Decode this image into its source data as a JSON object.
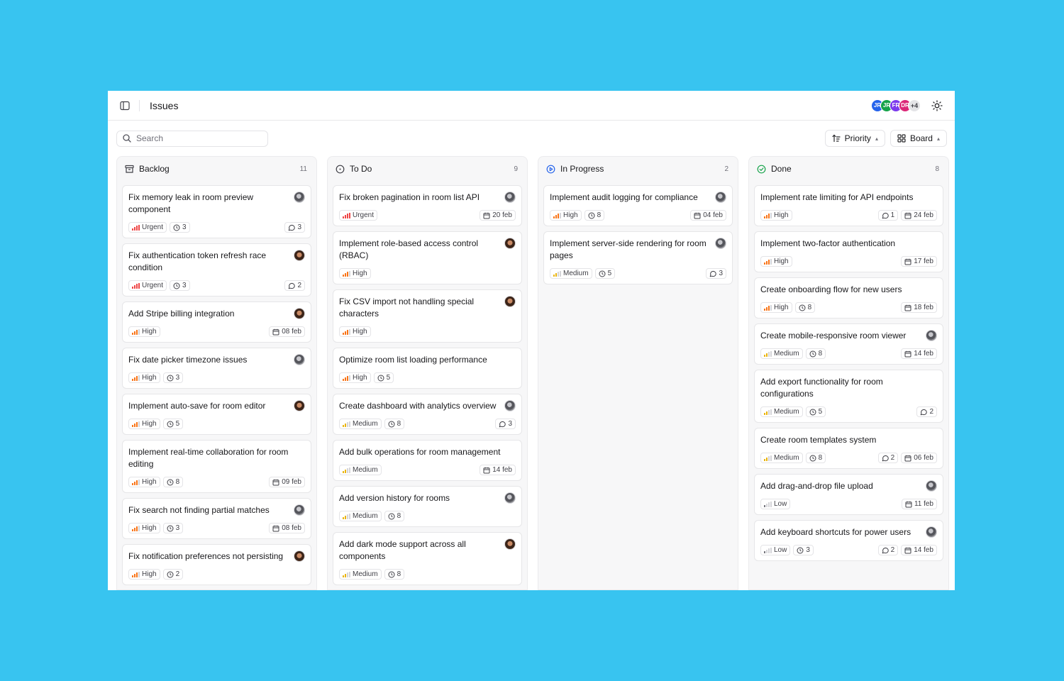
{
  "header": {
    "title": "Issues",
    "avatars": [
      {
        "initials": "JR",
        "color": "#2563eb"
      },
      {
        "initials": "JR",
        "color": "#16a34a"
      },
      {
        "initials": "FR",
        "color": "#7c3aed"
      },
      {
        "initials": "DR",
        "color": "#db2777"
      }
    ],
    "avatars_more": "+4"
  },
  "toolbar": {
    "search_placeholder": "Search",
    "priority_label": "Priority",
    "board_label": "Board"
  },
  "priority_colors": {
    "Urgent": "#ef4444",
    "High": "#f97316",
    "Medium": "#eab308",
    "Low": "#71717a"
  },
  "columns": [
    {
      "id": "backlog",
      "title": "Backlog",
      "count": "11",
      "icon": "archive-icon",
      "cards": [
        {
          "title": "Fix memory leak in room preview component",
          "avatar": "gray",
          "priority": "Urgent",
          "estimate": "3",
          "comments": "3",
          "date": ""
        },
        {
          "title": "Fix authentication token refresh race condition",
          "avatar": "brown",
          "priority": "Urgent",
          "estimate": "3",
          "comments": "2",
          "date": ""
        },
        {
          "title": "Add Stripe billing integration",
          "avatar": "brown",
          "priority": "High",
          "estimate": "",
          "comments": "",
          "date": "08 feb"
        },
        {
          "title": "Fix date picker timezone issues",
          "avatar": "gray",
          "priority": "High",
          "estimate": "3",
          "comments": "",
          "date": ""
        },
        {
          "title": "Implement auto-save for room editor",
          "avatar": "brown",
          "priority": "High",
          "estimate": "5",
          "comments": "",
          "date": ""
        },
        {
          "title": "Implement real-time collaboration for room editing",
          "avatar": "",
          "priority": "High",
          "estimate": "8",
          "comments": "",
          "date": "09 feb"
        },
        {
          "title": "Fix search not finding partial matches",
          "avatar": "gray",
          "priority": "High",
          "estimate": "3",
          "comments": "",
          "date": "08 feb"
        },
        {
          "title": "Fix notification preferences not persisting",
          "avatar": "brown",
          "priority": "High",
          "estimate": "2",
          "comments": "",
          "date": ""
        }
      ]
    },
    {
      "id": "todo",
      "title": "To Do",
      "count": "9",
      "icon": "circle-dashed-icon",
      "cards": [
        {
          "title": "Fix broken pagination in room list API",
          "avatar": "gray",
          "priority": "Urgent",
          "estimate": "",
          "comments": "",
          "date": "20 feb"
        },
        {
          "title": "Implement role-based access control (RBAC)",
          "avatar": "brown",
          "priority": "High",
          "estimate": "",
          "comments": "",
          "date": ""
        },
        {
          "title": "Fix CSV import not handling special characters",
          "avatar": "brown",
          "priority": "High",
          "estimate": "",
          "comments": "",
          "date": ""
        },
        {
          "title": "Optimize room list loading performance",
          "avatar": "",
          "priority": "High",
          "estimate": "5",
          "comments": "",
          "date": ""
        },
        {
          "title": "Create dashboard with analytics overview",
          "avatar": "gray",
          "priority": "Medium",
          "estimate": "8",
          "comments": "3",
          "date": ""
        },
        {
          "title": "Add bulk operations for room management",
          "avatar": "",
          "priority": "Medium",
          "estimate": "",
          "comments": "",
          "date": "14 feb"
        },
        {
          "title": "Add version history for rooms",
          "avatar": "gray",
          "priority": "Medium",
          "estimate": "8",
          "comments": "",
          "date": ""
        },
        {
          "title": "Add dark mode support across all components",
          "avatar": "brown",
          "priority": "Medium",
          "estimate": "8",
          "comments": "",
          "date": ""
        }
      ]
    },
    {
      "id": "in-progress",
      "title": "In Progress",
      "count": "2",
      "icon": "play-circle-icon",
      "cards": [
        {
          "title": "Implement audit logging for compliance",
          "avatar": "gray",
          "priority": "High",
          "estimate": "8",
          "comments": "",
          "date": "04 feb"
        },
        {
          "title": "Implement server-side rendering for room pages",
          "avatar": "gray",
          "priority": "Medium",
          "estimate": "5",
          "comments": "3",
          "date": ""
        }
      ]
    },
    {
      "id": "done",
      "title": "Done",
      "count": "8",
      "icon": "check-circle-icon",
      "cards": [
        {
          "title": "Implement rate limiting for API endpoints",
          "avatar": "",
          "priority": "High",
          "estimate": "",
          "comments": "1",
          "date": "24 feb"
        },
        {
          "title": "Implement two-factor authentication",
          "avatar": "",
          "priority": "High",
          "estimate": "",
          "comments": "",
          "date": "17 feb"
        },
        {
          "title": "Create onboarding flow for new users",
          "avatar": "",
          "priority": "High",
          "estimate": "8",
          "comments": "",
          "date": "18 feb"
        },
        {
          "title": "Create mobile-responsive room viewer",
          "avatar": "gray",
          "priority": "Medium",
          "estimate": "8",
          "comments": "",
          "date": "14 feb"
        },
        {
          "title": "Add export functionality for room configurations",
          "avatar": "",
          "priority": "Medium",
          "estimate": "5",
          "comments": "2",
          "date": ""
        },
        {
          "title": "Create room templates system",
          "avatar": "",
          "priority": "Medium",
          "estimate": "8",
          "comments": "2",
          "date": "06 feb"
        },
        {
          "title": "Add drag-and-drop file upload",
          "avatar": "gray",
          "priority": "Low",
          "estimate": "",
          "comments": "",
          "date": "11 feb"
        },
        {
          "title": "Add keyboard shortcuts for power users",
          "avatar": "gray",
          "priority": "Low",
          "estimate": "3",
          "comments": "2",
          "date": "14 feb"
        }
      ]
    }
  ]
}
